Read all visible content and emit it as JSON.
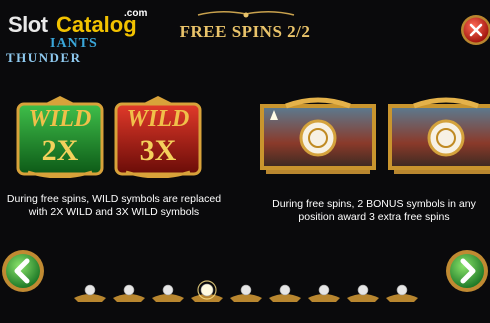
{
  "logo": {
    "word1": "Slot",
    "word2": "Catalog",
    "dotcom": ".com",
    "game_line1": "IANTS",
    "game_line2": "THUNDER"
  },
  "title": "FREE SPINS 2/2",
  "wild": {
    "symbol1_text": "WILD",
    "symbol1_mult": "2X",
    "symbol2_text": "WILD",
    "symbol2_mult": "3X",
    "caption_line1": "During free spins, WILD symbols are replaced",
    "caption_line2": "with 2X WILD and 3X WILD symbols"
  },
  "bonus": {
    "caption_line1": "During free spins, 2 BONUS symbols in any",
    "caption_line2": "position award 3 extra free spins"
  },
  "pagination": {
    "total": 9,
    "active_index": 3
  },
  "colors": {
    "gold": "#e9c36a",
    "green_button": "#3cb54a",
    "close_button": "#c8281e",
    "wild_green": "#1f8a2c",
    "wild_red": "#b01c14"
  },
  "icons": {
    "close": "close-icon",
    "prev": "chevron-left-icon",
    "next": "chevron-right-icon"
  }
}
